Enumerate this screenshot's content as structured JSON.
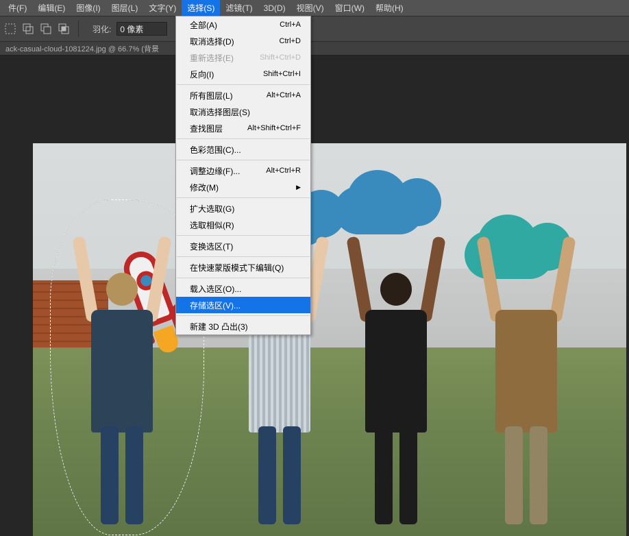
{
  "menubar": {
    "items": [
      {
        "label": "件(F)"
      },
      {
        "label": "编辑(E)"
      },
      {
        "label": "图像(I)"
      },
      {
        "label": "图层(L)"
      },
      {
        "label": "文字(Y)"
      },
      {
        "label": "选择(S)",
        "open": true
      },
      {
        "label": "滤镜(T)"
      },
      {
        "label": "3D(D)"
      },
      {
        "label": "视图(V)"
      },
      {
        "label": "窗口(W)"
      },
      {
        "label": "帮助(H)"
      }
    ]
  },
  "toolbar": {
    "feather_label": "羽化:",
    "feather_value": "0 像素"
  },
  "filetab": {
    "title": "ack-casual-cloud-1081224.jpg @ 66.7% (背景"
  },
  "dropdown": {
    "groups": [
      [
        {
          "label": "全部(A)",
          "shortcut": "Ctrl+A"
        },
        {
          "label": "取消选择(D)",
          "shortcut": "Ctrl+D"
        },
        {
          "label": "重新选择(E)",
          "shortcut": "Shift+Ctrl+D",
          "disabled": true
        },
        {
          "label": "反向(I)",
          "shortcut": "Shift+Ctrl+I"
        }
      ],
      [
        {
          "label": "所有图层(L)",
          "shortcut": "Alt+Ctrl+A"
        },
        {
          "label": "取消选择图层(S)"
        },
        {
          "label": "查找图层",
          "shortcut": "Alt+Shift+Ctrl+F"
        }
      ],
      [
        {
          "label": "色彩范围(C)..."
        }
      ],
      [
        {
          "label": "调整边缘(F)...",
          "shortcut": "Alt+Ctrl+R"
        },
        {
          "label": "修改(M)",
          "submenu": true
        }
      ],
      [
        {
          "label": "扩大选取(G)"
        },
        {
          "label": "选取相似(R)"
        }
      ],
      [
        {
          "label": "变换选区(T)"
        }
      ],
      [
        {
          "label": "在快速蒙版模式下编辑(Q)"
        }
      ],
      [
        {
          "label": "载入选区(O)..."
        },
        {
          "label": "存储选区(V)...",
          "hover": true
        }
      ],
      [
        {
          "label": "新建 3D 凸出(3)"
        }
      ]
    ]
  }
}
